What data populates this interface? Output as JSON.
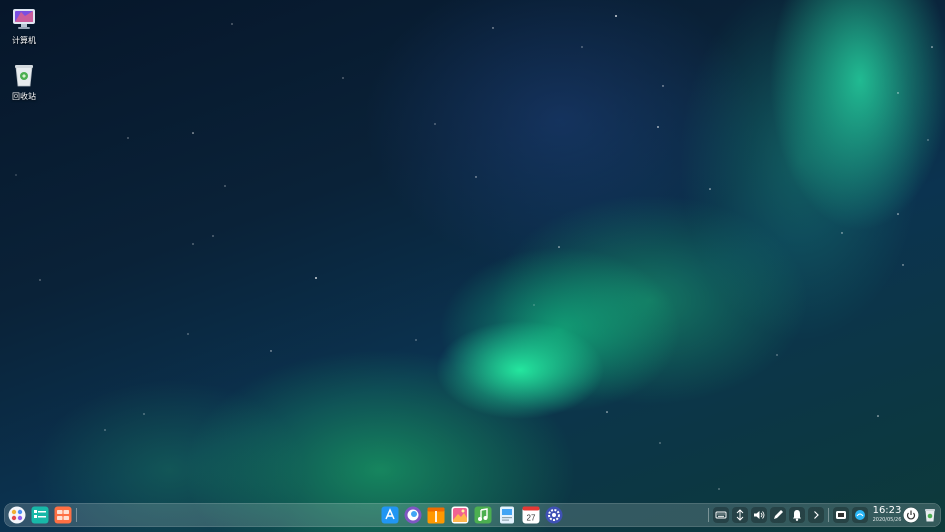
{
  "desktop": {
    "icons": [
      {
        "label": "计算机",
        "icon": "computer-icon"
      },
      {
        "label": "回收站",
        "icon": "trash-icon"
      }
    ]
  },
  "dock": {
    "left_apps": [
      "launcher-icon",
      "file-manager-icon",
      "multitask-view-icon"
    ],
    "center_apps": [
      "app-store-icon",
      "browser-icon",
      "archive-manager-icon",
      "image-viewer-icon",
      "music-icon",
      "document-viewer-icon",
      "calendar-icon",
      "settings-icon"
    ],
    "calendar_day": "27",
    "tray": [
      "keyboard-icon",
      "network-icon",
      "volume-icon",
      "pen-icon",
      "notification-bell-icon",
      "chevron-right-icon",
      "onboard-icon",
      "weather-icon"
    ],
    "clock": {
      "time": "16:23",
      "date": "2020/05/26"
    },
    "right_apps": [
      "power-icon",
      "trash-icon"
    ]
  },
  "colors": {
    "aurora_green": "#2affa8",
    "sky_dark": "#06162a",
    "dock_tint": "#ebf5f0"
  }
}
